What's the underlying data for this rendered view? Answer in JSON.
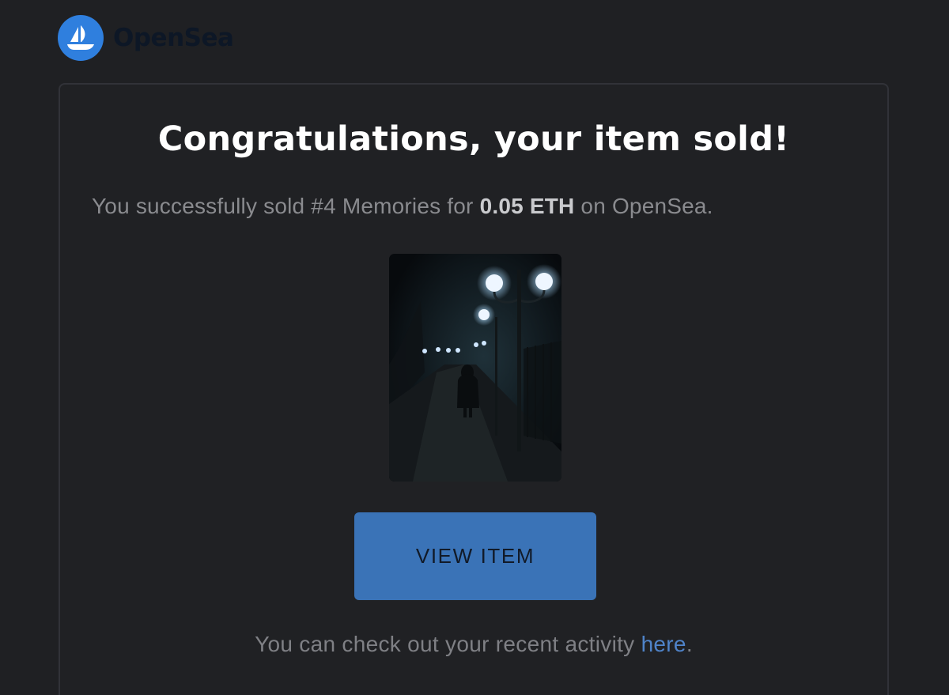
{
  "brand": {
    "name": "OpenSea",
    "logo_icon": "boat-icon",
    "logo_color": "#2f7fde"
  },
  "email": {
    "headline": "Congratulations, your item sold!",
    "summary_prefix": "You successfully sold #4 Memories for ",
    "price": "0.05 ETH",
    "summary_suffix": " on OpenSea.",
    "item_image_icon": "nft-photo-street-lamps",
    "button_label": "VIEW ITEM",
    "button_color": "#3a73b7",
    "activity_prefix": "You can check out your recent activity ",
    "activity_link": "here",
    "activity_suffix": ".",
    "link_color": "#4f83c9"
  }
}
